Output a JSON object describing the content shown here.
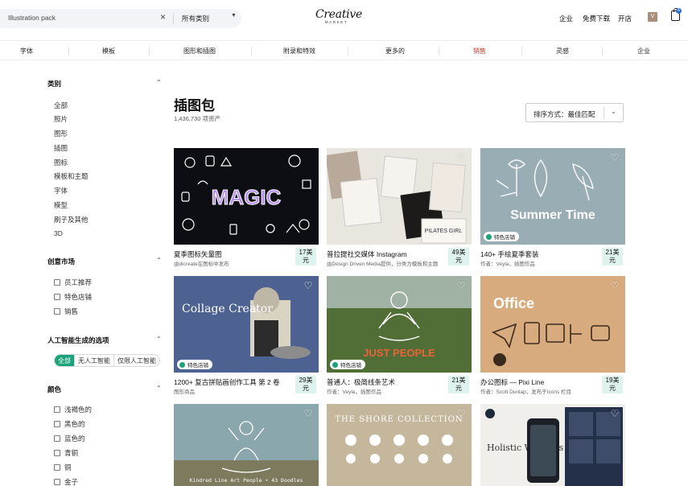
{
  "search": {
    "value": "Illustration pack",
    "category_value": "所有类别"
  },
  "logo": {
    "main": "Creative",
    "sub": "MARKET"
  },
  "header_links": {
    "business": "企业",
    "free": "免费下载",
    "open_shop": "开店",
    "avatar_letter": "V",
    "cart_badge": "6"
  },
  "nav": [
    "字体",
    "模板",
    "图形和插图",
    "附录和特效",
    "更多的",
    "销售",
    "灵感",
    "企业"
  ],
  "sidebar": {
    "category": {
      "heading": "类别",
      "items": [
        "全部",
        "照片",
        "图形",
        "插图",
        "图标",
        "模板和主题",
        "字体",
        "模型",
        "刷子及其他",
        "3D"
      ]
    },
    "market": {
      "heading": "创意市场",
      "items": [
        "员工推荐",
        "特色店铺",
        "销售"
      ]
    },
    "ai": {
      "heading": "人工智能生成的选项",
      "options": [
        "全部",
        "无人工智能",
        "仅限人工智能"
      ],
      "selected": "全部"
    },
    "color": {
      "heading": "颜色",
      "items": [
        "浅褐色的",
        "黑色的",
        "蓝色的",
        "青铜",
        "铜",
        "金子"
      ]
    }
  },
  "main": {
    "title": "插图包",
    "count": "1,436,730 项资产",
    "sort_label": "排序方式：最佳匹配"
  },
  "featured_label": "特色店铺",
  "cards": [
    {
      "title": "夏季图标矢量图",
      "sub": "由dicreate在图标中发布",
      "price_num": "17美",
      "price_unit": "元",
      "art": "MAGIC",
      "featured": false
    },
    {
      "title": "普拉提社交媒体 Instagram",
      "sub": "由Design Driven Media提供，分类为模板和主题",
      "price_num": "49美",
      "price_unit": "元",
      "art": "PILATES GIRL",
      "featured": false
    },
    {
      "title": "140+ 手绘夏季套装",
      "sub": "作者：Veyla，插图作品",
      "price_num": "21美",
      "price_unit": "元",
      "art": "Summer Time",
      "featured": true
    },
    {
      "title": "1200+ 复古拼贴画创作工具 第 2 卷",
      "sub": "图形商品",
      "price_num": "29美",
      "price_unit": "元",
      "art": "Collage Creator",
      "featured": true
    },
    {
      "title": "普通人：极简线条艺术",
      "sub": "作者：Veyla，插图作品",
      "price_num": "21美",
      "price_unit": "元",
      "art": "JUST PEOPLE",
      "featured": true
    },
    {
      "title": "办公图标 — Pixi Line",
      "sub": "作者：Scott Dunlap，发布于Icons 栏目",
      "price_num": "19美",
      "price_unit": "元",
      "art": "Office",
      "featured": false
    },
    {
      "title": "",
      "sub": "",
      "price_num": "",
      "price_unit": "",
      "art": "Kindred Line Art People • 43 Doodles",
      "featured": false
    },
    {
      "title": "",
      "sub": "",
      "price_num": "",
      "price_unit": "",
      "art": "THE SHORE COLLECTION",
      "featured": false
    },
    {
      "title": "",
      "sub": "",
      "price_num": "",
      "price_unit": "",
      "art": "Holistic Wellness",
      "featured": false
    }
  ]
}
